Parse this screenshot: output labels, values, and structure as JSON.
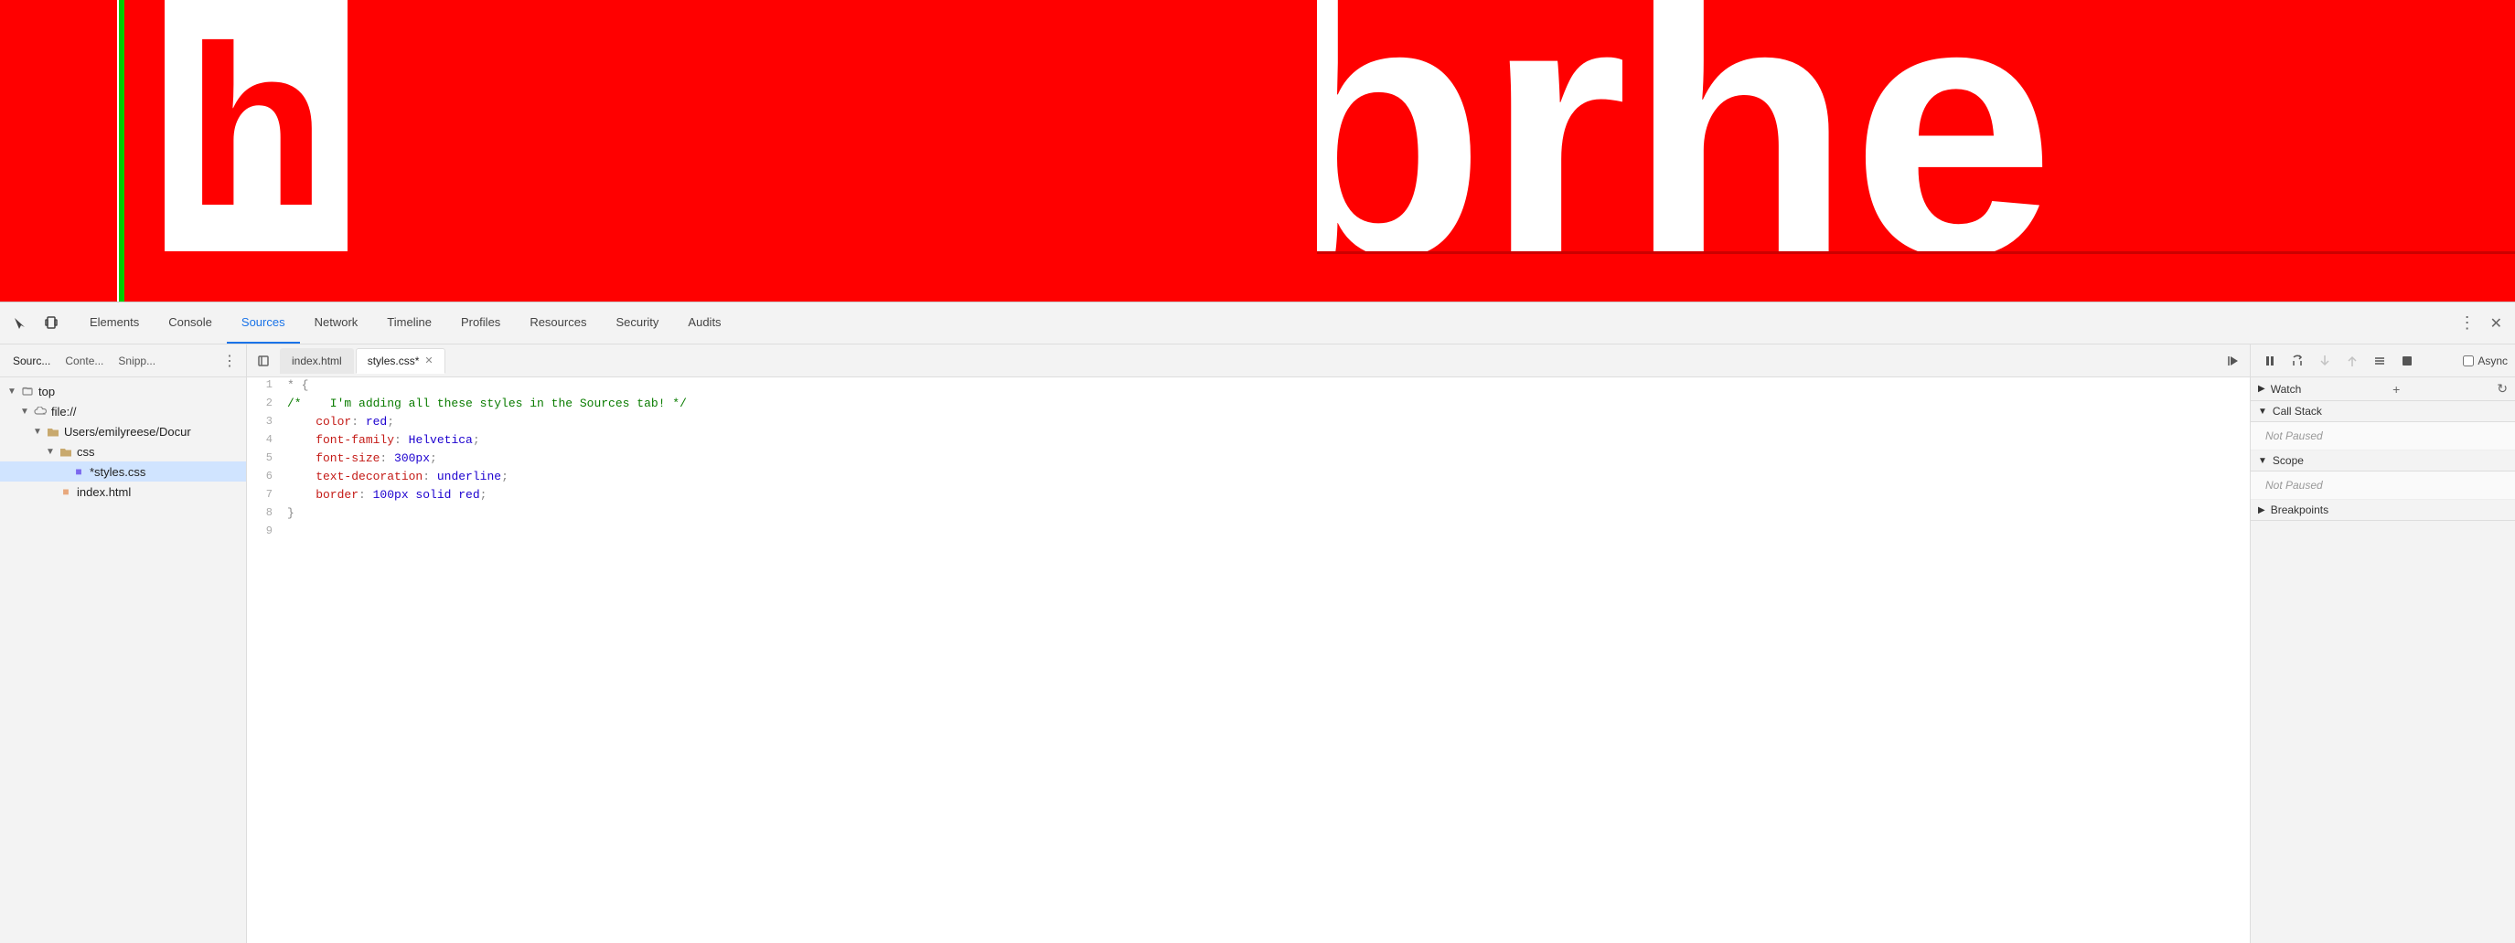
{
  "preview": {
    "letter": "h",
    "text_right": "brhe"
  },
  "devtools": {
    "toolbar": {
      "icons": [
        "cursor-icon",
        "device-icon"
      ],
      "tabs": [
        {
          "label": "Elements",
          "active": false
        },
        {
          "label": "Console",
          "active": false
        },
        {
          "label": "Sources",
          "active": true
        },
        {
          "label": "Network",
          "active": false
        },
        {
          "label": "Timeline",
          "active": false
        },
        {
          "label": "Profiles",
          "active": false
        },
        {
          "label": "Resources",
          "active": false
        },
        {
          "label": "Security",
          "active": false
        },
        {
          "label": "Audits",
          "active": false
        }
      ]
    },
    "sidebar": {
      "tabs": [
        {
          "label": "Sourc...",
          "active": true
        },
        {
          "label": "Conte...",
          "active": false
        },
        {
          "label": "Snipp...",
          "active": false
        }
      ],
      "tree": [
        {
          "label": "top",
          "indent": 0,
          "type": "tree-root",
          "expanded": true
        },
        {
          "label": "file://",
          "indent": 1,
          "type": "folder-cloud",
          "expanded": true
        },
        {
          "label": "Users/emilyreese/Docur",
          "indent": 2,
          "type": "folder",
          "expanded": true
        },
        {
          "label": "css",
          "indent": 3,
          "type": "folder-open",
          "expanded": true
        },
        {
          "label": "*styles.css",
          "indent": 4,
          "type": "file-css",
          "selected": true
        },
        {
          "label": "index.html",
          "indent": 3,
          "type": "file-html"
        }
      ]
    },
    "editor": {
      "tabs": [
        {
          "label": "index.html",
          "active": false,
          "closable": false
        },
        {
          "label": "styles.css*",
          "active": true,
          "closable": true
        }
      ],
      "lines": [
        {
          "num": 1,
          "tokens": [
            {
              "text": "* {",
              "color": "c-gray"
            }
          ]
        },
        {
          "num": 2,
          "tokens": [
            {
              "text": "/*",
              "color": "c-green"
            },
            {
              "text": "    I'm adding all these styles in the Sources tab! */",
              "color": "c-green"
            }
          ]
        },
        {
          "num": 3,
          "tokens": [
            {
              "text": "    color",
              "color": "c-red"
            },
            {
              "text": ": ",
              "color": "c-gray"
            },
            {
              "text": "red",
              "color": "c-blue"
            },
            {
              "text": ";",
              "color": "c-gray"
            }
          ]
        },
        {
          "num": 4,
          "tokens": [
            {
              "text": "    font-family",
              "color": "c-red"
            },
            {
              "text": ": ",
              "color": "c-gray"
            },
            {
              "text": "Helvetica",
              "color": "c-blue"
            },
            {
              "text": ";",
              "color": "c-gray"
            }
          ]
        },
        {
          "num": 5,
          "tokens": [
            {
              "text": "    font-size",
              "color": "c-red"
            },
            {
              "text": ": ",
              "color": "c-gray"
            },
            {
              "text": "300px",
              "color": "c-blue"
            },
            {
              "text": ";",
              "color": "c-gray"
            }
          ]
        },
        {
          "num": 6,
          "tokens": [
            {
              "text": "    text-decoration",
              "color": "c-red"
            },
            {
              "text": ": ",
              "color": "c-gray"
            },
            {
              "text": "underline",
              "color": "c-blue"
            },
            {
              "text": ";",
              "color": "c-gray"
            }
          ]
        },
        {
          "num": 7,
          "tokens": [
            {
              "text": "    border",
              "color": "c-red"
            },
            {
              "text": ": ",
              "color": "c-gray"
            },
            {
              "text": "100px solid red",
              "color": "c-blue"
            },
            {
              "text": ";",
              "color": "c-gray"
            }
          ]
        },
        {
          "num": 8,
          "tokens": [
            {
              "text": "}",
              "color": "c-gray"
            }
          ]
        },
        {
          "num": 9,
          "tokens": []
        }
      ]
    },
    "right_panel": {
      "debug_buttons": [
        {
          "name": "pause-icon",
          "symbol": "⏸",
          "disabled": false
        },
        {
          "name": "step-over-icon",
          "symbol": "↺",
          "disabled": false
        },
        {
          "name": "step-into-icon",
          "symbol": "↓",
          "disabled": true
        },
        {
          "name": "step-out-icon",
          "symbol": "↑",
          "disabled": true
        },
        {
          "name": "deactivate-icon",
          "symbol": "⚡",
          "disabled": false
        },
        {
          "name": "stop-icon",
          "symbol": "⏹",
          "disabled": false
        }
      ],
      "async_label": "Async",
      "sections": [
        {
          "name": "watch",
          "label": "Watch",
          "expanded": true,
          "actions": [
            "+",
            "↺"
          ],
          "content": null
        },
        {
          "name": "call-stack",
          "label": "Call Stack",
          "expanded": true,
          "content": "Not Paused"
        },
        {
          "name": "scope",
          "label": "Scope",
          "expanded": true,
          "content": "Not Paused"
        },
        {
          "name": "breakpoints",
          "label": "Breakpoints",
          "expanded": false,
          "content": null
        }
      ]
    }
  }
}
